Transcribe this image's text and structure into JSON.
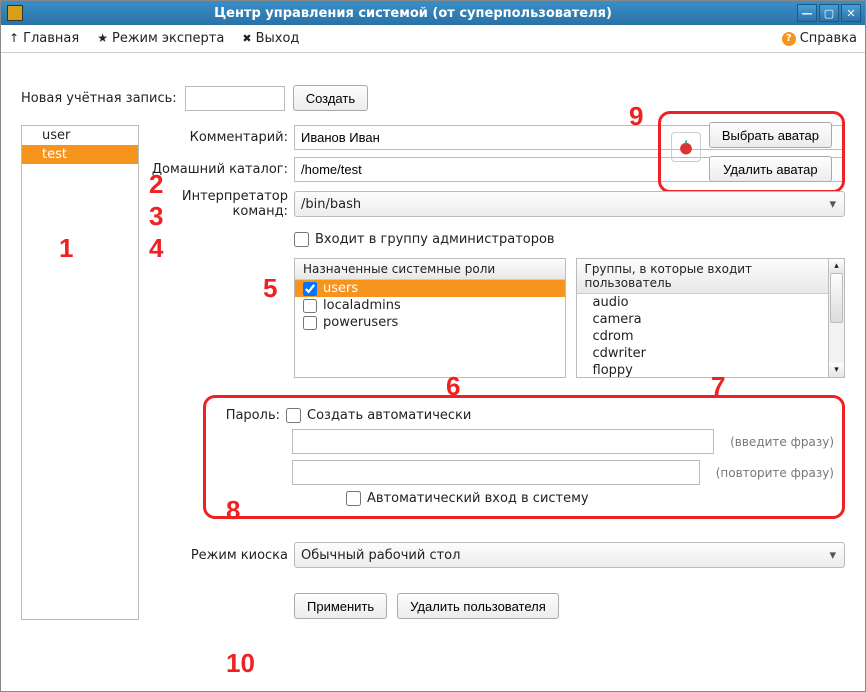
{
  "window": {
    "title": "Центр управления системой (от суперпользователя)"
  },
  "menubar": {
    "home": "Главная",
    "expert": "Режим эксперта",
    "exit": "Выход",
    "help": "Справка"
  },
  "newacct": {
    "label": "Новая учётная запись:",
    "value": "",
    "create": "Создать"
  },
  "avatar": {
    "choose": "Выбрать аватар",
    "remove": "Удалить аватар"
  },
  "users": {
    "items": [
      "user",
      "test"
    ],
    "selected": 1
  },
  "form": {
    "comment_label": "Комментарий:",
    "comment_value": "Иванов Иван",
    "home_label": "Домашний каталог:",
    "home_value": "/home/test",
    "shell_label": "Интерпретатор команд:",
    "shell_value": "/bin/bash",
    "admin_label": "Входит в группу администраторов",
    "roles_header": "Назначенные системные роли",
    "roles": [
      {
        "name": "users",
        "checked": true,
        "selected": true
      },
      {
        "name": "localadmins",
        "checked": false,
        "selected": false
      },
      {
        "name": "powerusers",
        "checked": false,
        "selected": false
      }
    ],
    "groups_header": "Группы, в которые входит пользователь",
    "groups": [
      "audio",
      "camera",
      "cdrom",
      "cdwriter",
      "floppy"
    ]
  },
  "password": {
    "label": "Пароль:",
    "autogen": "Создать автоматически",
    "hint1": "(введите фразу)",
    "hint2": "(повторите фразу)",
    "autologin": "Автоматический вход в систему"
  },
  "kiosk": {
    "label": "Режим киоска",
    "value": "Обычный рабочий стол"
  },
  "actions": {
    "apply": "Применить",
    "delete": "Удалить пользователя"
  },
  "annotations": [
    "1",
    "2",
    "3",
    "4",
    "5",
    "6",
    "7",
    "8",
    "9",
    "10"
  ]
}
